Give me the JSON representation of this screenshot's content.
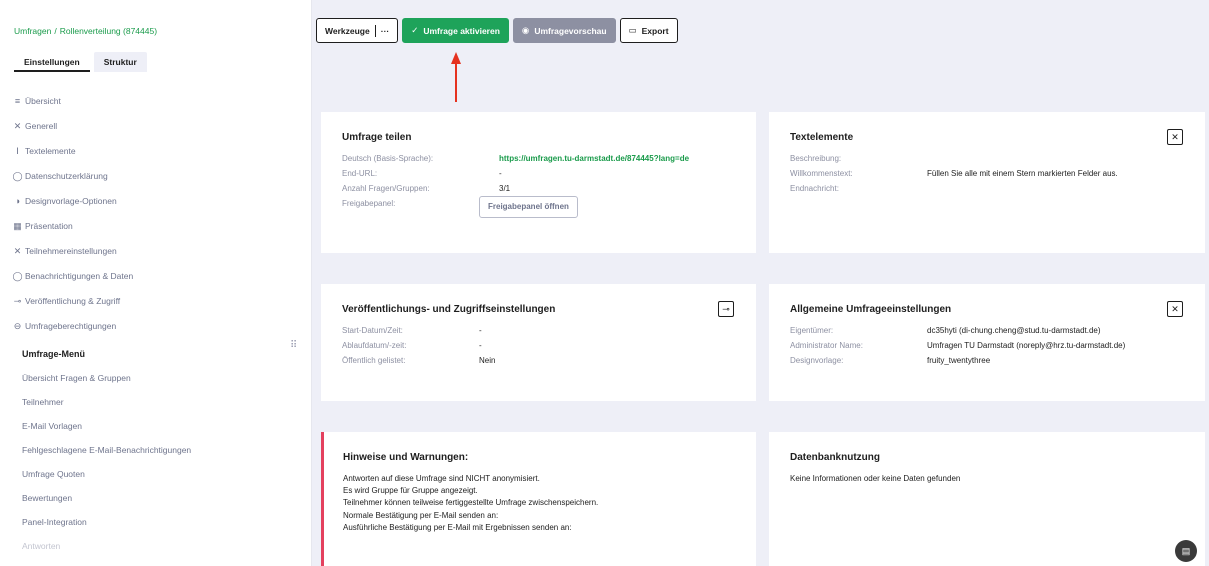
{
  "breadcrumb": {
    "root": "Umfragen",
    "separator": "/",
    "current": "Rollenverteilung (874445)"
  },
  "tabs": [
    {
      "label": "Einstellungen"
    },
    {
      "label": "Struktur"
    }
  ],
  "sidebar": {
    "items": [
      {
        "icon": "≡",
        "label": "Übersicht"
      },
      {
        "icon": "✕",
        "label": "Generell"
      },
      {
        "icon": "Ⅰ",
        "label": "Textelemente"
      },
      {
        "icon": "◯",
        "label": "Datenschutzerklärung"
      },
      {
        "icon": "◑",
        "label": "Designvorlage-Optionen"
      },
      {
        "icon": "▦",
        "label": "Präsentation"
      },
      {
        "icon": "✕",
        "label": "Teilnehmereinstellungen"
      },
      {
        "icon": "◯",
        "label": "Benachrichtigungen & Daten"
      },
      {
        "icon": "⊸",
        "label": "Veröffentlichung & Zugriff"
      },
      {
        "icon": "⊖",
        "label": "Umfrageberechtigungen"
      }
    ],
    "submenu": {
      "title": "Umfrage-Menü",
      "items": [
        {
          "label": "Übersicht Fragen & Gruppen"
        },
        {
          "label": "Teilnehmer"
        },
        {
          "label": "E-Mail Vorlagen"
        },
        {
          "label": "Fehlgeschlagene E-Mail-Benachrichtigungen"
        },
        {
          "label": "Umfrage Quoten"
        },
        {
          "label": "Bewertungen"
        },
        {
          "label": "Panel-Integration"
        },
        {
          "label": "Antworten"
        }
      ]
    },
    "drag_icon": "⠿"
  },
  "toolbar": {
    "tools_label": "Werkzeuge",
    "more_label": "···",
    "activate_icon": "✓",
    "activate_label": "Umfrage aktivieren",
    "preview_icon": "◉",
    "preview_label": "Umfragevorschau",
    "export_icon": "▭",
    "export_label": "Export"
  },
  "share": {
    "title": "Umfrage teilen",
    "rows": [
      {
        "key": "Deutsch (Basis-Sprache):",
        "value": "https://umfragen.tu-darmstadt.de/874445?lang=de"
      },
      {
        "key": "End-URL:",
        "value": "-"
      },
      {
        "key": "Anzahl Fragen/Gruppen:",
        "value": "3/1"
      },
      {
        "key": "Freigabepanel:",
        "value": ""
      }
    ],
    "panel_button": "Freigabepanel öffnen"
  },
  "text_elements": {
    "title": "Textelemente",
    "icon": "✕",
    "rows": [
      {
        "key": "Beschreibung:",
        "value": ""
      },
      {
        "key": "Willkommenstext:",
        "value": "Füllen Sie alle mit einem Stern markierten Felder aus."
      },
      {
        "key": "Endnachricht:",
        "value": ""
      }
    ]
  },
  "publish": {
    "title": "Veröffentlichungs- und Zugriffseinstellungen",
    "icon": "⊸",
    "rows": [
      {
        "key": "Start-Datum/Zeit:",
        "value": "-"
      },
      {
        "key": "Ablaufdatum/-zeit:",
        "value": "-"
      },
      {
        "key": "Öffentlich gelistet:",
        "value": "Nein"
      }
    ]
  },
  "general": {
    "title": "Allgemeine Umfrageeinstellungen",
    "icon": "✕",
    "rows": [
      {
        "key": "Eigentümer:",
        "value": "dc35hyti (di-chung.cheng@stud.tu-darmstadt.de)"
      },
      {
        "key": "Administrator Name:",
        "value": "Umfragen TU Darmstadt (noreply@hrz.tu-darmstadt.de)"
      },
      {
        "key": "Designvorlage:",
        "value": "fruity_twentythree"
      }
    ]
  },
  "warnings": {
    "title": "Hinweise und Warnungen:",
    "lines": [
      "Antworten auf diese Umfrage sind NICHT anonymisiert.",
      "Es wird Gruppe für Gruppe angezeigt.",
      "Teilnehmer können teilweise fertiggestellte Umfrage zwischenspeichern.",
      "Normale Bestätigung per E-Mail senden an:",
      "Ausführliche Bestätigung per E-Mail mit Ergebnissen senden an:"
    ]
  },
  "database": {
    "title": "Datenbanknutzung",
    "text": "Keine Informationen oder keine Daten gefunden"
  },
  "chat_icon": "▤",
  "colors": {
    "accent": "#1ea35a",
    "warning": "#e4405e",
    "arrow": "#e5321f"
  }
}
